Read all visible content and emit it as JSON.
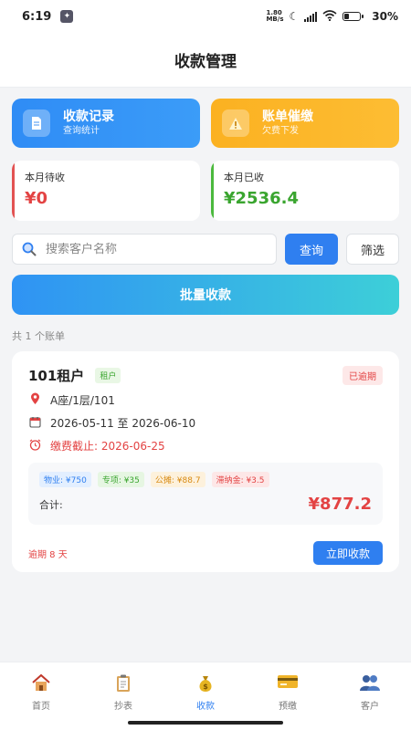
{
  "status": {
    "time": "6:19",
    "net_speed_top": "1.80",
    "net_speed_bottom": "MB/s",
    "battery": "30%"
  },
  "header": {
    "title": "收款管理"
  },
  "actions": [
    {
      "title": "收款记录",
      "subtitle": "查询统计",
      "icon": "document-icon",
      "color": "#2f8cf5"
    },
    {
      "title": "账单催缴",
      "subtitle": "欠费下发",
      "icon": "warning-icon",
      "color": "#fbb121"
    }
  ],
  "stats": {
    "pending": {
      "label": "本月待收",
      "value": "¥0",
      "color": "#e34343"
    },
    "received": {
      "label": "本月已收",
      "value": "¥2536.4",
      "color": "#3aa52f"
    }
  },
  "search": {
    "placeholder": "搜索客户名称",
    "query_label": "查询",
    "filter_label": "筛选"
  },
  "batch_label": "批量收款",
  "count_text": "共 1 个账单",
  "bills": [
    {
      "name": "101租户",
      "tag": "租户",
      "status": "已逾期",
      "location": "A座/1层/101",
      "period": "2026-05-11 至 2026-06-10",
      "due": "缴费截止: 2026-06-25",
      "fees": [
        "物业: ¥750",
        "专项: ¥35",
        "公摊: ¥88.7",
        "滞纳金: ¥3.5"
      ],
      "total_label": "合计:",
      "total_value": "¥877.2",
      "overdue_days": "逾期 8 天",
      "collect_label": "立即收款"
    }
  ],
  "tabs": [
    {
      "label": "首页",
      "icon": "home-icon",
      "active": false
    },
    {
      "label": "抄表",
      "icon": "clipboard-icon",
      "active": false
    },
    {
      "label": "收款",
      "icon": "money-bag-icon",
      "active": true
    },
    {
      "label": "预缴",
      "icon": "card-icon",
      "active": false
    },
    {
      "label": "客户",
      "icon": "users-icon",
      "active": false
    }
  ],
  "accent_color": "#2f7ff0"
}
